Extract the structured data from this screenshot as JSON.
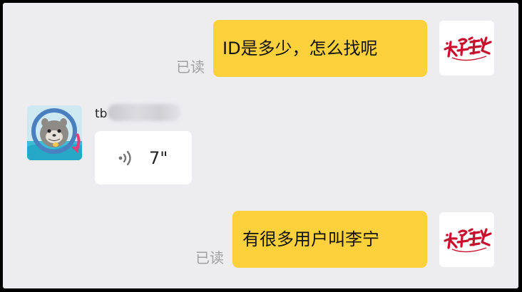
{
  "messages": [
    {
      "text": "ID是多少，怎么找呢",
      "read_label": "已读"
    },
    {
      "sender": "tb",
      "voice_duration": "7\""
    },
    {
      "text": "有很多用户叫李宁",
      "read_label": "已读"
    }
  ],
  "colors": {
    "background": "#ededf0",
    "my_bubble": "#fdd13c",
    "other_bubble": "#ffffff",
    "read_text": "#a0a0a0",
    "brand_red": "#c8102e"
  },
  "icons": {
    "my_avatar": "brand-logo-icon",
    "other_avatar": "otter-avatar-icon",
    "voice": "voice-wave-icon"
  }
}
